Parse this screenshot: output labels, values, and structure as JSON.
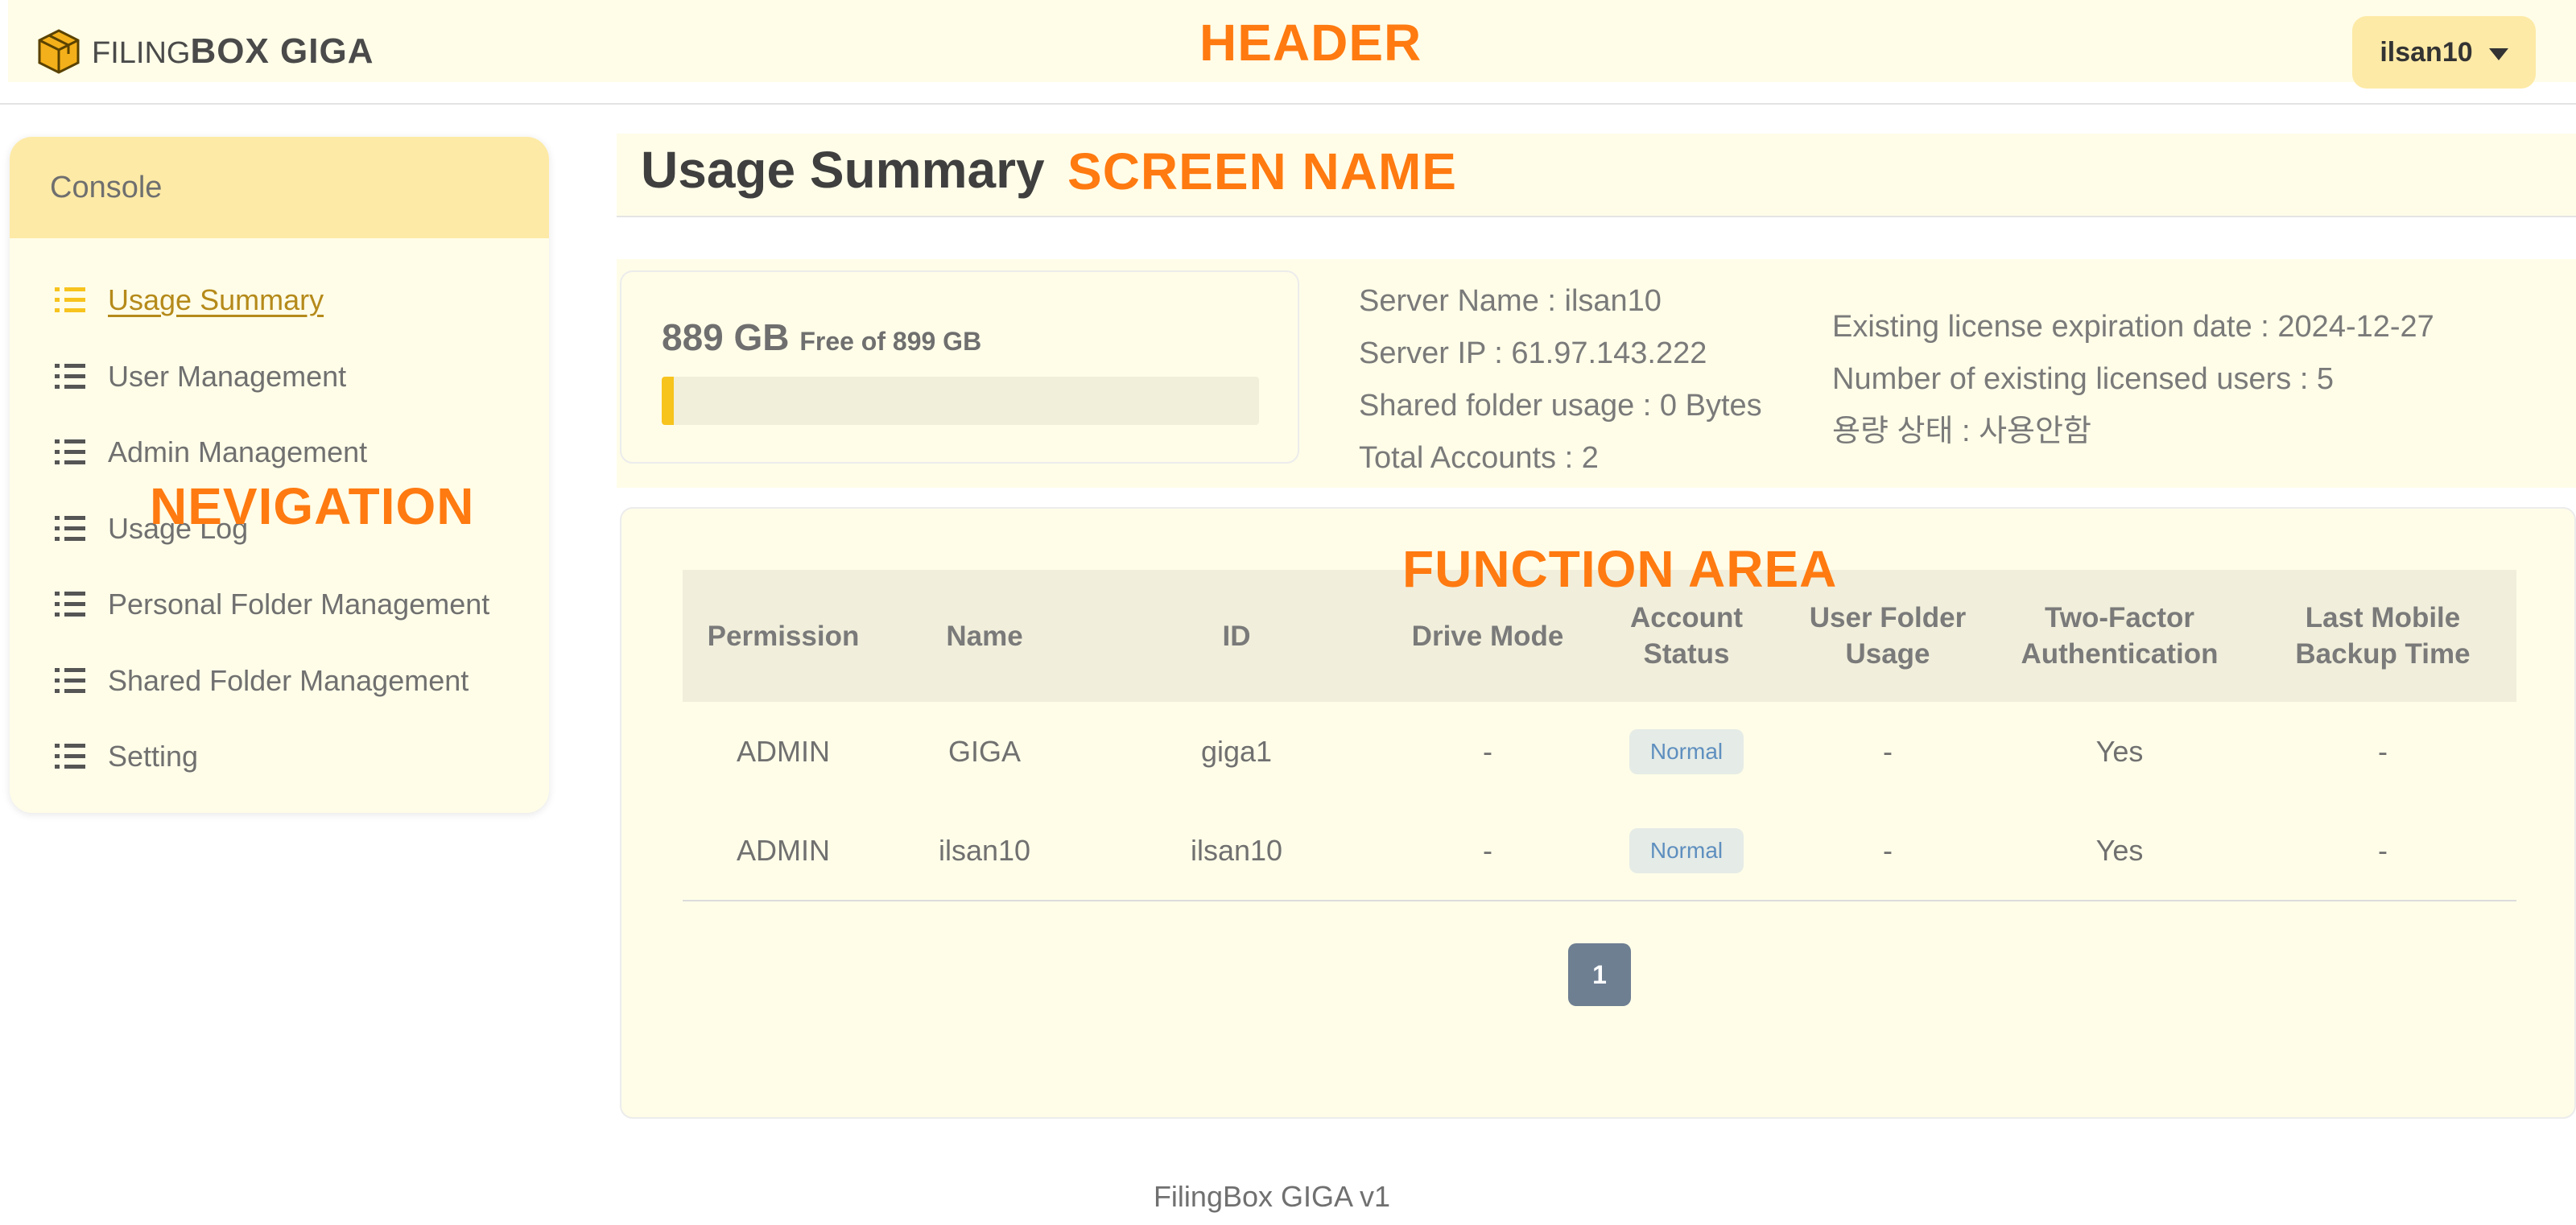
{
  "header": {
    "logo_text_light": "FILING",
    "logo_text_bold": "BOX GIGA",
    "user": "ilsan10",
    "annotation": "HEADER"
  },
  "sidebar": {
    "title": "Console",
    "annotation": "NEVIGATION",
    "items": [
      {
        "label": "Usage Summary",
        "active": true
      },
      {
        "label": "User Management"
      },
      {
        "label": "Admin Management"
      },
      {
        "label": "Usage Log"
      },
      {
        "label": "Personal Folder Management"
      },
      {
        "label": "Shared Folder Management"
      },
      {
        "label": "Setting"
      }
    ]
  },
  "main": {
    "title": "Usage Summary",
    "title_annotation": "SCREEN NAME",
    "storage": {
      "used": "889 GB",
      "free_text": "Free of 899 GB",
      "percent_used": 1
    },
    "server_info": [
      "Server Name : ilsan10",
      "Server IP : 61.97.143.222",
      "Shared folder usage : 0 Bytes",
      "Total Accounts : 2"
    ],
    "license_info": [
      "Existing license expiration date : 2024-12-27",
      "Number of existing licensed users : 5",
      "용량 상태 : 사용안함"
    ],
    "function_annotation": "FUNCTION AREA",
    "table": {
      "headers": [
        [
          "Permission"
        ],
        [
          "Name"
        ],
        [
          "ID"
        ],
        [
          "Drive Mode"
        ],
        [
          "Account",
          "Status"
        ],
        [
          "User Folder",
          "Usage"
        ],
        [
          "Two-Factor",
          "Authentication"
        ],
        [
          "Last Mobile",
          "Backup Time"
        ]
      ],
      "rows": [
        {
          "permission": "ADMIN",
          "name": "GIGA",
          "id": "giga1",
          "drive_mode": "-",
          "status": "Normal",
          "folder_usage": "-",
          "two_factor": "Yes",
          "backup": "-"
        },
        {
          "permission": "ADMIN",
          "name": "ilsan10",
          "id": "ilsan10",
          "drive_mode": "-",
          "status": "Normal",
          "folder_usage": "-",
          "two_factor": "Yes",
          "backup": "-"
        }
      ]
    },
    "pager": "1"
  },
  "footer": "FilingBox GIGA v1",
  "colors": {
    "accent": "#f7c31d",
    "annotation": "#ff7a10",
    "panel": "#fffde8",
    "pager": "#6e7f92"
  }
}
